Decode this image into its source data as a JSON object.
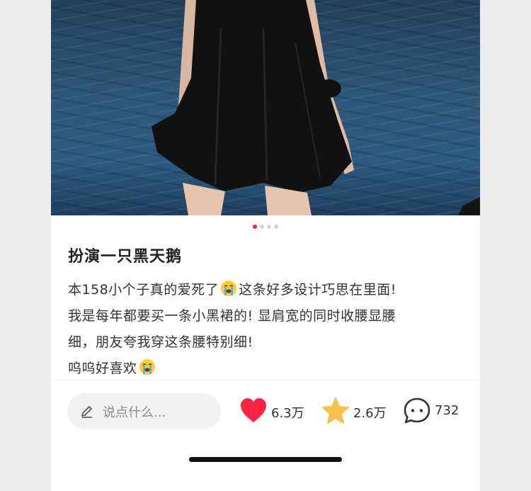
{
  "post": {
    "image_count": 4,
    "active_image_index": 0,
    "title": "扮演一只黑天鹅",
    "desc_lines": [
      {
        "before": "本158小个子真的爱死了",
        "emoji": "loudly-crying-emoji",
        "after": "这条好多设计巧思在里面!"
      },
      {
        "before": "我是每年都要买一条小黑裙的! 显肩宽的同时收腰显腰",
        "emoji": "",
        "after": ""
      },
      {
        "before": "细，朋友夸我穿这条腰特别细!",
        "emoji": "",
        "after": ""
      },
      {
        "before": "呜呜好喜欢",
        "emoji": "loudly-crying-emoji",
        "after": ""
      }
    ]
  },
  "bottom_bar": {
    "comment_placeholder": "说点什么...",
    "like_count": "6.3万",
    "collect_count": "2.6万",
    "comment_count": "732",
    "icons": {
      "edit": "pencil-icon",
      "like": "heart-icon",
      "collect": "star-icon",
      "comment": "chat-bubble-icon"
    },
    "colors": {
      "like": "#ff2442",
      "collect": "#f5c14a",
      "active_dot": "#ff2442"
    }
  }
}
